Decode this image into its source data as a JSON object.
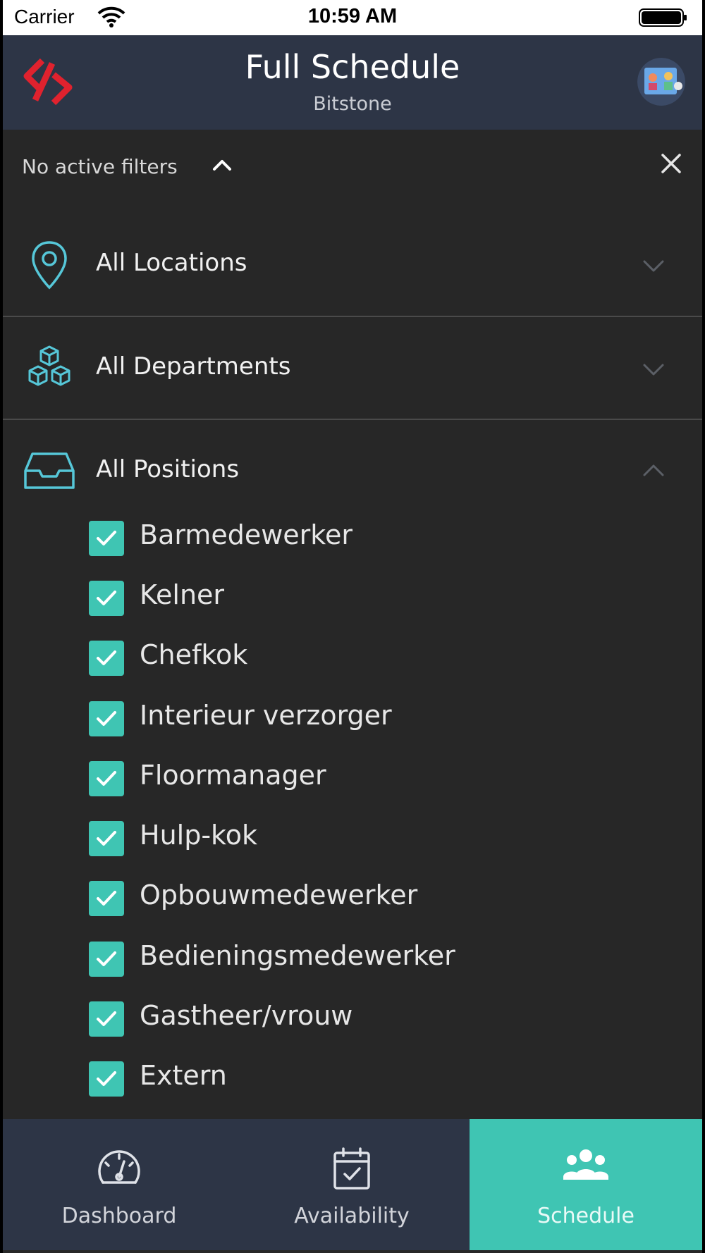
{
  "status_bar": {
    "carrier": "Carrier",
    "time": "10:59 AM"
  },
  "header": {
    "title": "Full Schedule",
    "subtitle": "Bitstone"
  },
  "filter_bar": {
    "text": "No active filters"
  },
  "sections": {
    "locations": {
      "label": "All Locations",
      "icon": "map-pin-icon",
      "expanded": false
    },
    "departments": {
      "label": "All Departments",
      "icon": "cubes-icon",
      "expanded": false
    },
    "positions": {
      "label": "All Positions",
      "icon": "inbox-tray-icon",
      "expanded": true
    }
  },
  "positions": [
    {
      "label": "Barmedewerker",
      "checked": true
    },
    {
      "label": "Kelner",
      "checked": true
    },
    {
      "label": "Chefkok",
      "checked": true
    },
    {
      "label": "Interieur verzorger",
      "checked": true
    },
    {
      "label": "Floormanager",
      "checked": true
    },
    {
      "label": "Hulp-kok",
      "checked": true
    },
    {
      "label": "Opbouwmedewerker",
      "checked": true
    },
    {
      "label": "Bedieningsmedewerker",
      "checked": true
    },
    {
      "label": "Gastheer/vrouw",
      "checked": true
    },
    {
      "label": "Extern",
      "checked": true
    }
  ],
  "tabs": [
    {
      "label": "Dashboard",
      "icon": "speedometer-icon",
      "active": false
    },
    {
      "label": "Availability",
      "icon": "calendar-check-icon",
      "active": false
    },
    {
      "label": "Schedule",
      "icon": "people-icon",
      "active": true
    }
  ],
  "colors": {
    "accent": "#3fc5b3",
    "header_bg": "#2d3546",
    "panel_bg": "#272727",
    "brand": "#e0222e"
  }
}
